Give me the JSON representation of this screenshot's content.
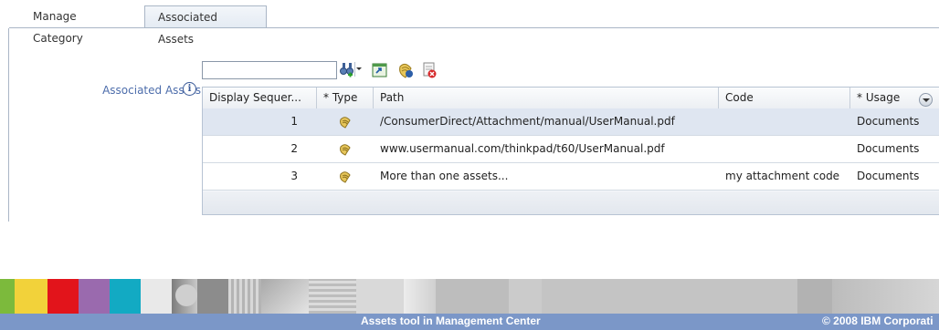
{
  "tabs": [
    {
      "label": "Manage Category",
      "active": false
    },
    {
      "label": "Associated Assets",
      "active": true
    }
  ],
  "field": {
    "label": "Associated Assets",
    "info_icon": "info-icon"
  },
  "toolbar": {
    "search_value": "",
    "icons": [
      "find-binoculars-icon",
      "open-object-icon",
      "add-asset-icon",
      "remove-asset-icon"
    ]
  },
  "grid": {
    "columns": [
      "Display Sequer...",
      "* Type",
      "Path",
      "Code",
      "* Usage"
    ],
    "rows": [
      {
        "sequence": "1",
        "type_icon": "attachment-icon",
        "path": "/ConsumerDirect/Attachment/manual/UserManual.pdf",
        "code": "",
        "usage": "Documents",
        "selected": true
      },
      {
        "sequence": "2",
        "type_icon": "attachment-icon",
        "path": "www.usermanual.com/thinkpad/t60/UserManual.pdf",
        "code": "",
        "usage": "Documents",
        "selected": false
      },
      {
        "sequence": "3",
        "type_icon": "attachment-icon",
        "path": "More than one assets...",
        "code": "my attachment code",
        "usage": "Documents",
        "selected": false
      }
    ]
  },
  "footer": {
    "title": "Assets tool in Management Center",
    "copyright": "© 2008 IBM Corporati"
  },
  "colors": {
    "accent_blue": "#7b97c8",
    "label_blue": "#4d6dab",
    "selected_row": "#dfe6f1",
    "banner_yellow": "#f2d23a",
    "banner_red": "#e2141b",
    "banner_purple": "#9a6aae",
    "banner_cyan": "#12aac3"
  }
}
